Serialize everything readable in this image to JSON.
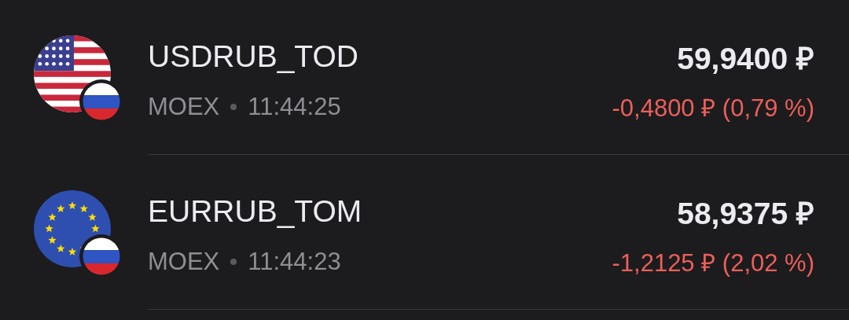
{
  "instruments": [
    {
      "kind": "usd",
      "ticker": "USDRUB_TOD",
      "exchange": "MOEX",
      "time": "11:44:25",
      "price": "59,9400 ₽",
      "change": "-0,4800 ₽ (0,79 %)"
    },
    {
      "kind": "eur",
      "ticker": "EURRUB_TOM",
      "exchange": "MOEX",
      "time": "11:44:23",
      "price": "58,9375 ₽",
      "change": "-1,2125 ₽ (2,02 %)"
    }
  ]
}
